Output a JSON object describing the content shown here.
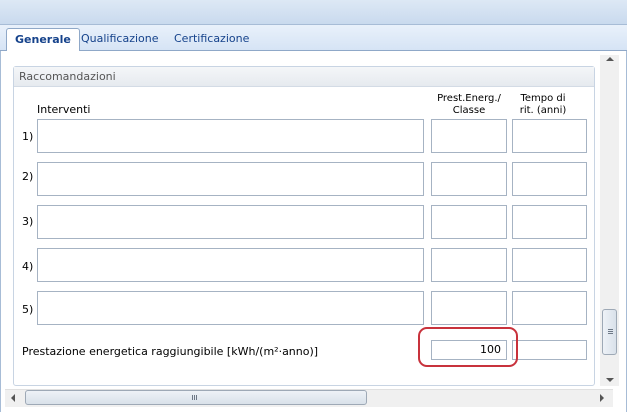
{
  "tabs": [
    {
      "label": "Generale",
      "active": true
    },
    {
      "label": "Qualificazione",
      "active": false
    },
    {
      "label": "Certificazione",
      "active": false
    }
  ],
  "group": {
    "title": "Raccomandazioni"
  },
  "columns": {
    "interventi": "Interventi",
    "prest_line1": "Prest.Energ./",
    "prest_line2": "Classe",
    "tempo_line1": "Tempo di",
    "tempo_line2": "rit. (anni)"
  },
  "rows": [
    {
      "label": "1)",
      "intervento": "",
      "prest": "",
      "tempo": ""
    },
    {
      "label": "2)",
      "intervento": "",
      "prest": "",
      "tempo": ""
    },
    {
      "label": "3)",
      "intervento": "",
      "prest": "",
      "tempo": ""
    },
    {
      "label": "4)",
      "intervento": "",
      "prest": "",
      "tempo": ""
    },
    {
      "label": "5)",
      "intervento": "",
      "prest": "",
      "tempo": ""
    }
  ],
  "prestazione": {
    "label": "Prestazione energetica raggiungibile  [kWh/(m²·anno)]",
    "value": "100",
    "tempo": ""
  },
  "colors": {
    "tab_text": "#15428b",
    "highlight": "#c8323c"
  }
}
